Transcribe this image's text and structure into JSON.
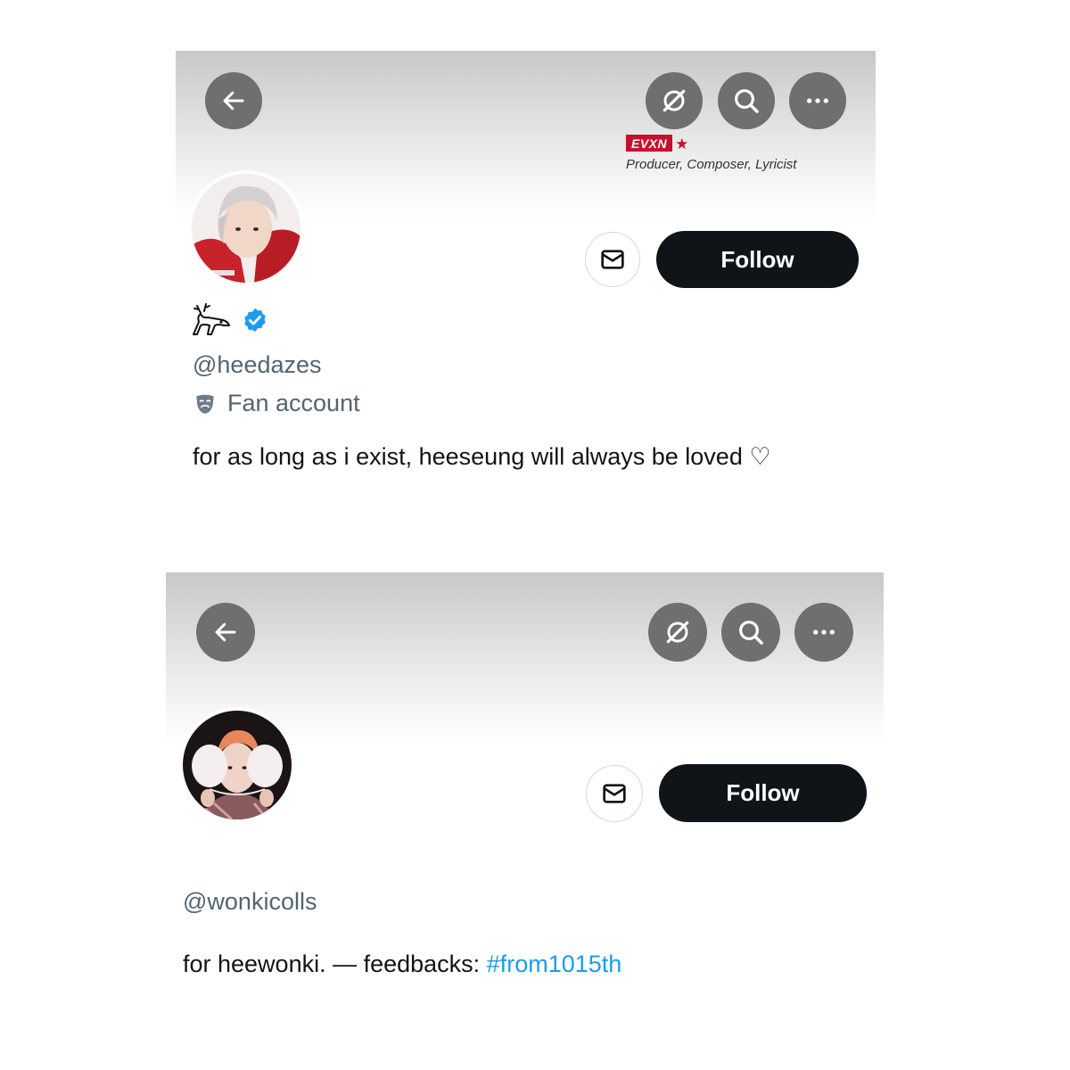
{
  "profile_1": {
    "header_buttons": {
      "back_icon": "arrow-left-icon",
      "grok_icon": "grok-icon",
      "search_icon": "search-icon",
      "more_icon": "more-icon"
    },
    "sponsor": {
      "tag": "EVXN",
      "star": "★",
      "subtitle": "Producer, Composer, Lyricist"
    },
    "display_name_icon": "deer-emoji-icon",
    "verified": true,
    "handle": "@heedazes",
    "category": {
      "icon": "performing-arts-icon",
      "label": "Fan account"
    },
    "follow_label": "Follow",
    "bio": "for as long as i exist, heeseung will always be loved ♡"
  },
  "profile_2": {
    "header_buttons": {
      "back_icon": "arrow-left-icon",
      "grok_icon": "grok-icon",
      "search_icon": "search-icon",
      "more_icon": "more-icon"
    },
    "handle": "@wonkicolls",
    "follow_label": "Follow",
    "bio_text": "for heewonki. — feedbacks: ",
    "bio_hashtag": "#from1015th"
  },
  "colors": {
    "follow_bg": "#0f1419",
    "verified_blue": "#1d9bf0",
    "link_blue": "#1d9bf0",
    "sponsor_red": "#c8102e",
    "header_button_bg": "#6f6f6f",
    "secondary_text": "#536471"
  }
}
